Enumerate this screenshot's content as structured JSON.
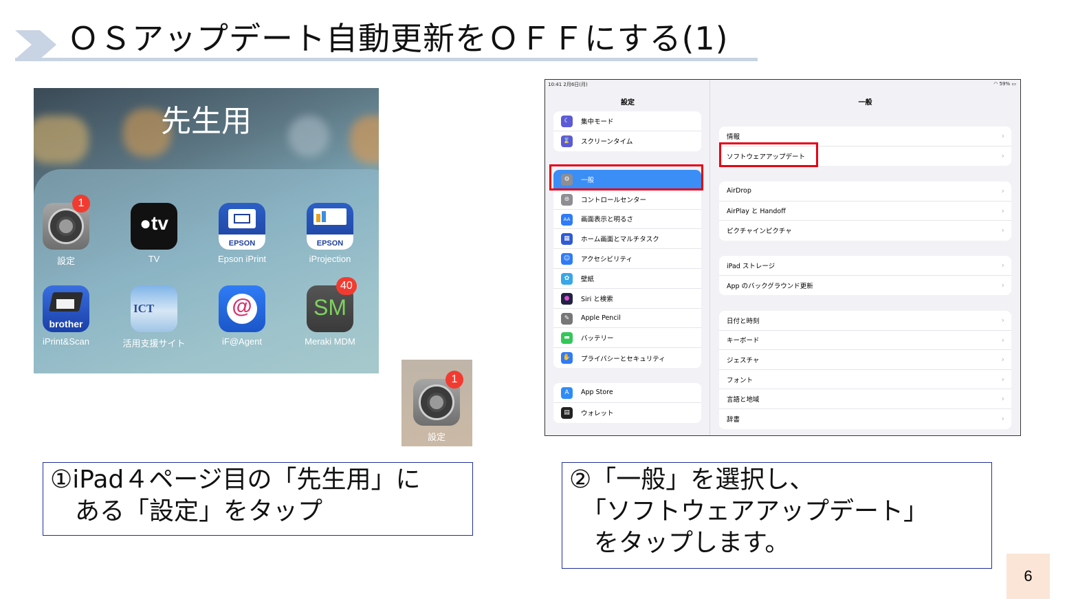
{
  "title": "ＯＳアップデート自動更新をＯＦＦにする(1)",
  "folder": {
    "name": "先生用",
    "apps": [
      {
        "label": "設定",
        "icon": "settings-gear-icon",
        "badge": "1"
      },
      {
        "label": "TV",
        "icon": "apple-tv-icon",
        "icon_text": "tv",
        "badge": ""
      },
      {
        "label": "Epson iPrint",
        "icon": "epson-iprint-icon",
        "icon_text": "EPSON",
        "badge": ""
      },
      {
        "label": "iProjection",
        "icon": "epson-iprojection-icon",
        "icon_text": "EPSON",
        "badge": ""
      },
      {
        "label": "iPrint&Scan",
        "icon": "brother-iprint-scan-icon",
        "icon_text": "brother",
        "badge": ""
      },
      {
        "label": "活用支援サイト",
        "icon": "ict-support-site-icon",
        "icon_text": "ICT",
        "badge": ""
      },
      {
        "label": "iF@Agent",
        "icon": "if-agent-icon",
        "icon_text": "@",
        "badge": ""
      },
      {
        "label": "Meraki MDM",
        "icon": "meraki-mdm-icon",
        "icon_text": "SM",
        "badge": "40"
      }
    ]
  },
  "mini_settings": {
    "label": "設定",
    "badge": "1"
  },
  "ipad": {
    "status_time": "10:41  2月6日(月)",
    "status_battery": "59%",
    "sidebar_title": "設定",
    "main_title": "一般",
    "sidebar_group1": [
      {
        "label": "集中モード",
        "icon": "moon-icon",
        "color": "#5b5bd6",
        "glyph": "☾"
      },
      {
        "label": "スクリーンタイム",
        "icon": "hourglass-icon",
        "color": "#5b5bd6",
        "glyph": "⌛"
      }
    ],
    "sidebar_group2": [
      {
        "label": "一般",
        "icon": "gear-icon",
        "color": "#8e8e93",
        "glyph": "⚙",
        "selected": true
      },
      {
        "label": "コントロールセンター",
        "icon": "toggles-icon",
        "color": "#8e8e93",
        "glyph": "⊜"
      },
      {
        "label": "画面表示と明るさ",
        "icon": "text-size-icon",
        "color": "#2f7cf6",
        "glyph": "AA"
      },
      {
        "label": "ホーム画面とマルチタスク",
        "icon": "grid-icon",
        "color": "#2f5bd6",
        "glyph": "▦"
      },
      {
        "label": "アクセシビリティ",
        "icon": "accessibility-icon",
        "color": "#2f7cf6",
        "glyph": "☺"
      },
      {
        "label": "壁紙",
        "icon": "flower-icon",
        "color": "#37a7e8",
        "glyph": "✿"
      },
      {
        "label": "Siri と検索",
        "icon": "siri-icon",
        "color": "#222244",
        "glyph": "●"
      },
      {
        "label": "Apple Pencil",
        "icon": "pencil-icon",
        "color": "#777777",
        "glyph": "✎"
      },
      {
        "label": "バッテリー",
        "icon": "battery-icon",
        "color": "#34c759",
        "glyph": "▬"
      },
      {
        "label": "プライバシーとセキュリティ",
        "icon": "hand-icon",
        "color": "#2f7cf6",
        "glyph": "✋"
      }
    ],
    "sidebar_group3": [
      {
        "label": "App Store",
        "icon": "app-store-icon",
        "color": "#2f8cf6",
        "glyph": "A"
      },
      {
        "label": "ウォレット",
        "icon": "wallet-icon",
        "color": "#222222",
        "glyph": "▤"
      }
    ],
    "main_group1": [
      "情報",
      "ソフトウェアアップデート"
    ],
    "main_group2": [
      "AirDrop",
      "AirPlay と Handoff",
      "ピクチャインピクチャ"
    ],
    "main_group3": [
      "iPad ストレージ",
      "App のバックグラウンド更新"
    ],
    "main_group4": [
      "日付と時刻",
      "キーボード",
      "ジェスチャ",
      "フォント",
      "言語と地域",
      "辞書"
    ]
  },
  "caption1": {
    "line1": "①iPad４ページ目の「先生用」に",
    "line2": "　ある「設定」をタップ"
  },
  "caption2": {
    "line1": "②「一般」を選択し、",
    "line2": "　「ソフトウェアアップデート」",
    "line3": "　をタップします。"
  },
  "page_number": "6",
  "colors": {
    "highlight": "#e60012",
    "caption_border": "#1f2d9b",
    "selected_row": "#3b8ef5",
    "page_badge": "#fbe5d6"
  }
}
